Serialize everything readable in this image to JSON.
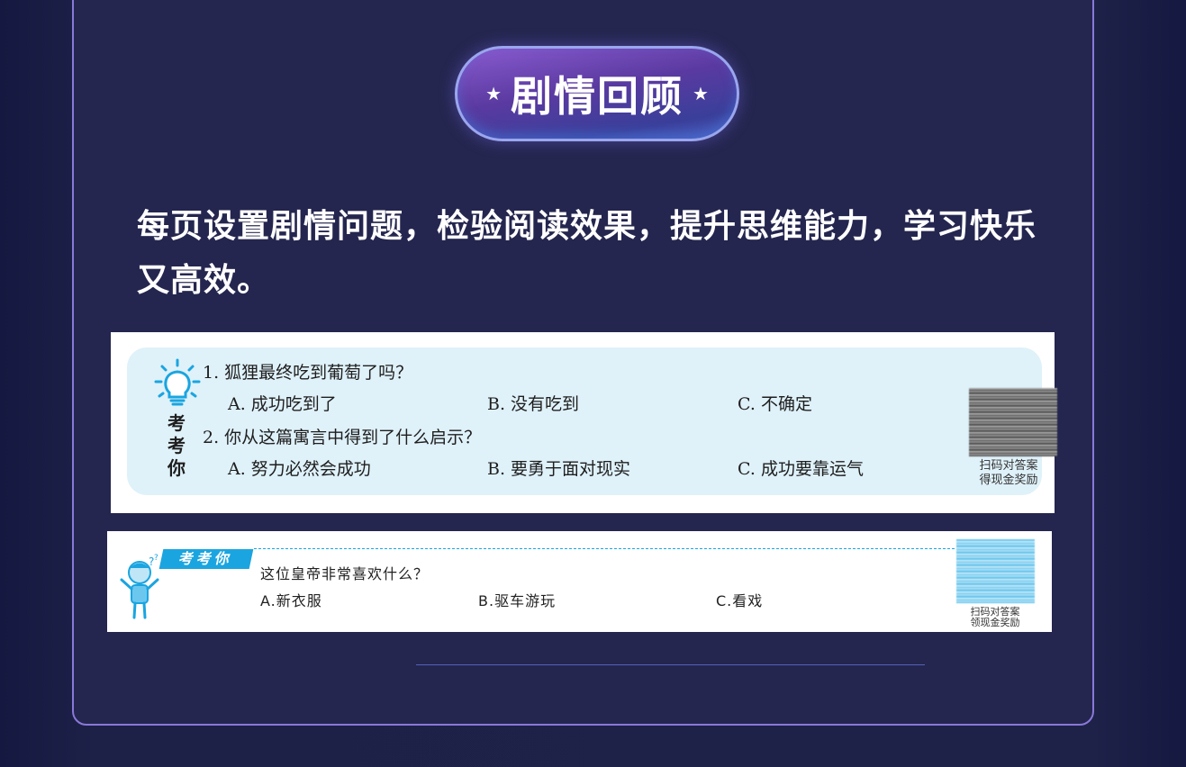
{
  "section": {
    "title": "剧情回顾",
    "star_left": "★",
    "star_right": "★",
    "description": "每页设置剧情问题，检验阅读效果，提升思维能力，学习快乐又高效。"
  },
  "card1": {
    "label": "考考你",
    "questions": [
      {
        "text": "1. 狐狸最终吃到葡萄了吗？",
        "options": [
          "A. 成功吃到了",
          "B. 没有吃到",
          "C. 不确定"
        ]
      },
      {
        "text": "2. 你从这篇寓言中得到了什么启示？",
        "options": [
          "A. 努力必然会成功",
          "B. 要勇于面对现实",
          "C. 成功要靠运气"
        ]
      }
    ],
    "scan_line1": "扫码对答案",
    "scan_line2": "得现金奖励"
  },
  "card2": {
    "tag": "考考你",
    "question": "这位皇帝非常喜欢什么？",
    "options": [
      "A.新衣服",
      "B.驱车游玩",
      "C.看戏"
    ],
    "scan_line1": "扫码对答案",
    "scan_line2": "领现金奖励"
  },
  "colors": {
    "accent": "#1aa5e0",
    "card_bg": "#dff1f9",
    "panel_border": "#8a78d8"
  }
}
